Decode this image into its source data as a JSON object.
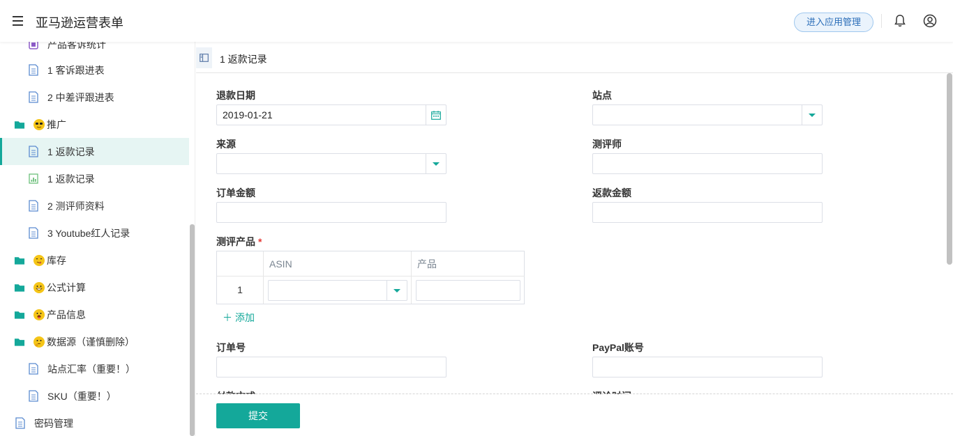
{
  "header": {
    "app_title": "亚马逊运营表单",
    "manage_button": "进入应用管理"
  },
  "sidebar": {
    "items": [
      {
        "label": "产品客诉统计",
        "type": "form"
      },
      {
        "label": "1 客诉跟进表",
        "type": "doc"
      },
      {
        "label": "2 中差评跟进表",
        "type": "doc"
      },
      {
        "label": "推广",
        "type": "folder",
        "emoji": "sunglasses"
      },
      {
        "label": "1 返款记录",
        "type": "doc",
        "active": true
      },
      {
        "label": "1 返款记录",
        "type": "report"
      },
      {
        "label": "2 测评师资料",
        "type": "doc"
      },
      {
        "label": "3 Youtube红人记录",
        "type": "doc"
      },
      {
        "label": "库存",
        "type": "folder",
        "emoji": "yum"
      },
      {
        "label": "公式计算",
        "type": "folder",
        "emoji": "grin"
      },
      {
        "label": "产品信息",
        "type": "folder",
        "emoji": "tongue"
      },
      {
        "label": "数据源（谨慎删除）",
        "type": "folder",
        "emoji": "thinking"
      },
      {
        "label": "站点汇率（重要！）",
        "type": "doc"
      },
      {
        "label": "SKU（重要！）",
        "type": "doc"
      },
      {
        "label": "密码管理",
        "type": "doc"
      }
    ]
  },
  "tab": {
    "title": "1 返款记录"
  },
  "form": {
    "refund_date": {
      "label": "退款日期",
      "value": "2019-01-21"
    },
    "site": {
      "label": "站点",
      "value": ""
    },
    "source": {
      "label": "来源",
      "value": ""
    },
    "reviewer": {
      "label": "测评师",
      "value": ""
    },
    "order_amount": {
      "label": "订单金额",
      "value": ""
    },
    "refund_amount": {
      "label": "返款金额",
      "value": ""
    },
    "product": {
      "label": "测评产品",
      "required_mark": "*",
      "columns": [
        "ASIN",
        "产品"
      ],
      "rows": [
        {
          "index": "1",
          "asin": "",
          "product": ""
        }
      ],
      "add_label": "添加"
    },
    "order_no": {
      "label": "订单号",
      "value": ""
    },
    "paypal": {
      "label": "PayPal账号",
      "value": ""
    },
    "payment_method": {
      "label": "付款方式"
    },
    "review_time": {
      "label": "评论时间"
    }
  },
  "footer": {
    "submit": "提交"
  },
  "colors": {
    "accent": "#14a89a",
    "active_bg": "#e6f5f3"
  }
}
